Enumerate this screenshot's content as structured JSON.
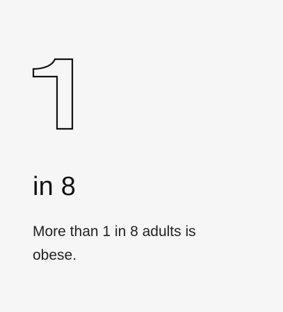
{
  "stat": {
    "figure": "1",
    "headline": "in 8",
    "description": "More than 1 in 8 adults is obese."
  },
  "colors": {
    "background": "#f6f6f6",
    "text": "#111111",
    "outline": "#111111"
  }
}
